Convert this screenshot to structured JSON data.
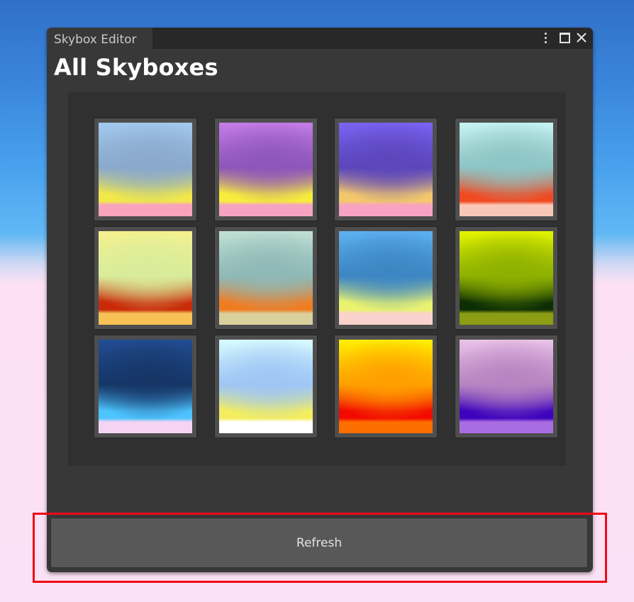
{
  "window": {
    "tab_title": "Skybox Editor",
    "controls": {
      "menu_icon": "kebab-menu-icon",
      "maximize_icon": "maximize-icon",
      "close_icon": "close-icon"
    }
  },
  "main": {
    "heading": "All Skyboxes",
    "refresh_label": "Refresh"
  },
  "highlight_color": "#ee0a16",
  "skyboxes": [
    {
      "name": "skybox-1",
      "colors": [
        "#a3c9ef",
        "#8aa9cc",
        "#f1e84a",
        "#f9a3bd"
      ]
    },
    {
      "name": "skybox-2",
      "colors": [
        "#c57de8",
        "#8e56ba",
        "#f6ee3b",
        "#f5a3c0"
      ]
    },
    {
      "name": "skybox-3",
      "colors": [
        "#7b63f3",
        "#5b46bc",
        "#f3c86c",
        "#f8a3c2"
      ]
    },
    {
      "name": "skybox-4",
      "colors": [
        "#c5f3f2",
        "#8ec4c4",
        "#f04a22",
        "#f9c7b7"
      ]
    },
    {
      "name": "skybox-5",
      "colors": [
        "#f5f18f",
        "#d9ec9a",
        "#c92b09",
        "#f6c256"
      ]
    },
    {
      "name": "skybox-6",
      "colors": [
        "#c0e1d4",
        "#8fb9b7",
        "#f07c22",
        "#d9d09d"
      ]
    },
    {
      "name": "skybox-7",
      "colors": [
        "#5db1ef",
        "#3d86c4",
        "#eaf36f",
        "#f9d2cc"
      ]
    },
    {
      "name": "skybox-8",
      "colors": [
        "#e3f400",
        "#8eb000",
        "#0c2e05",
        "#8c9d14"
      ]
    },
    {
      "name": "skybox-9",
      "colors": [
        "#224d94",
        "#163667",
        "#4dc4ff",
        "#f5d4f3"
      ]
    },
    {
      "name": "skybox-10",
      "colors": [
        "#d8fbff",
        "#9fc6f5",
        "#f4ee5e",
        "#ffffff"
      ]
    },
    {
      "name": "skybox-11",
      "colors": [
        "#fff000",
        "#ff9f00",
        "#f20a00",
        "#fd6e00"
      ]
    },
    {
      "name": "skybox-12",
      "colors": [
        "#eac4e8",
        "#b784c1",
        "#3e04bd",
        "#a96de2"
      ]
    }
  ]
}
